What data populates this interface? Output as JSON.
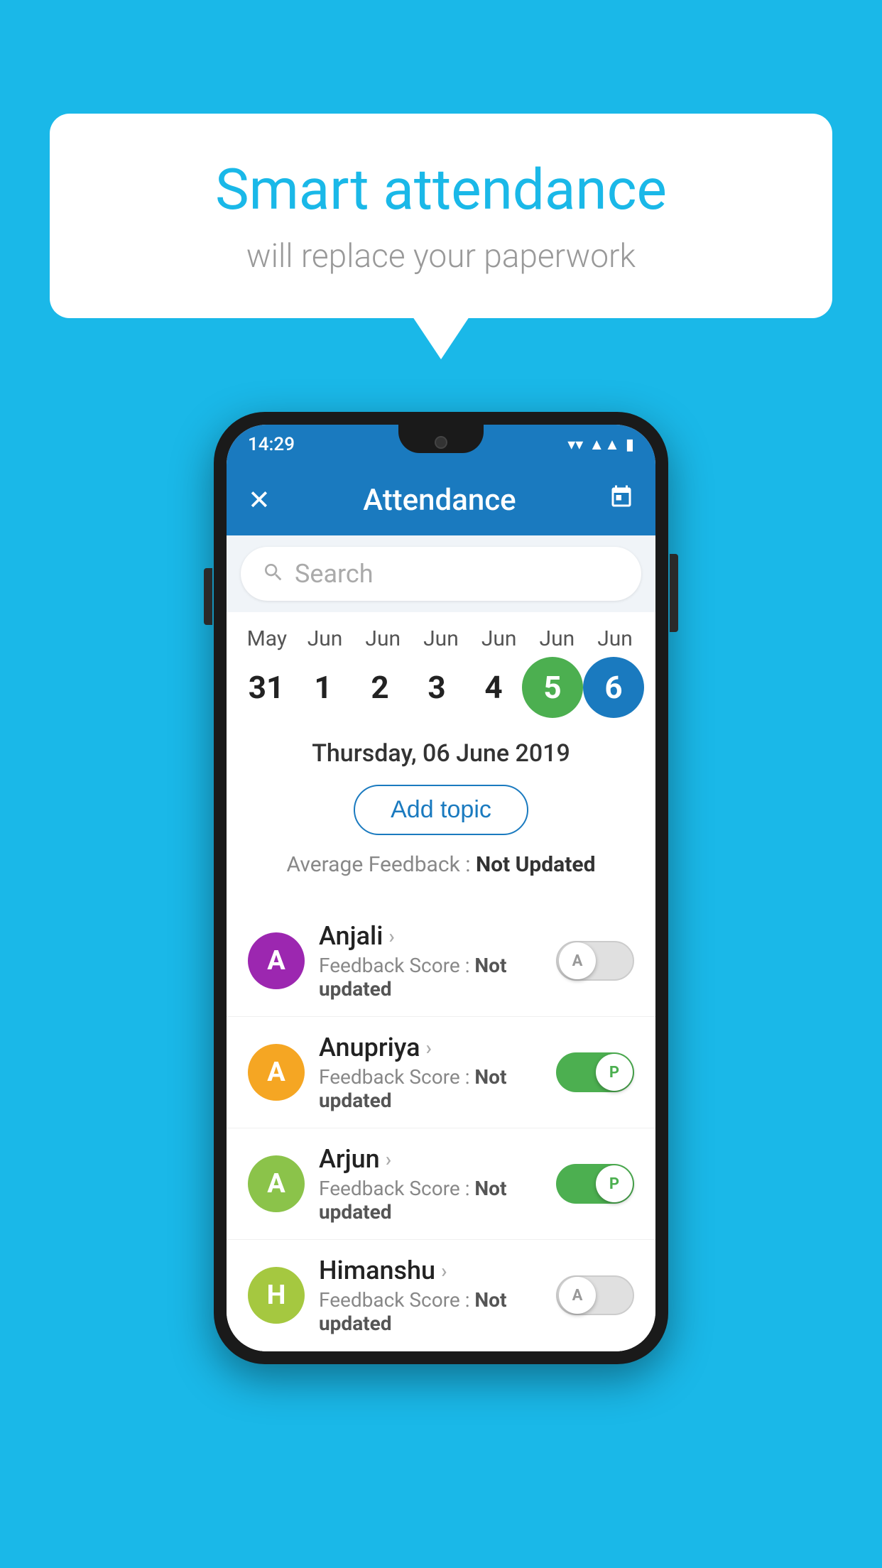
{
  "background": {
    "color": "#1ab8e8"
  },
  "speech_bubble": {
    "title": "Smart attendance",
    "subtitle": "will replace your paperwork"
  },
  "status_bar": {
    "time": "14:29",
    "wifi": "▼",
    "signal": "▲",
    "battery": "▮"
  },
  "app_bar": {
    "title": "Attendance",
    "close_icon": "✕",
    "calendar_icon": "📅"
  },
  "search": {
    "placeholder": "Search"
  },
  "calendar": {
    "months": [
      "May",
      "Jun",
      "Jun",
      "Jun",
      "Jun",
      "Jun",
      "Jun"
    ],
    "days": [
      "31",
      "1",
      "2",
      "3",
      "4",
      "5",
      "6"
    ],
    "selected_green": "5",
    "selected_blue": "6"
  },
  "selected_date": "Thursday, 06 June 2019",
  "add_topic_label": "Add topic",
  "avg_feedback_label": "Average Feedback : ",
  "avg_feedback_value": "Not Updated",
  "students": [
    {
      "name": "Anjali",
      "avatar_letter": "A",
      "avatar_color": "#9c27b0",
      "feedback_label": "Feedback Score : ",
      "feedback_value": "Not updated",
      "toggle_state": "off",
      "toggle_letter": "A"
    },
    {
      "name": "Anupriya",
      "avatar_letter": "A",
      "avatar_color": "#f5a623",
      "feedback_label": "Feedback Score : ",
      "feedback_value": "Not updated",
      "toggle_state": "on",
      "toggle_letter": "P"
    },
    {
      "name": "Arjun",
      "avatar_letter": "A",
      "avatar_color": "#8bc34a",
      "feedback_label": "Feedback Score : ",
      "feedback_value": "Not updated",
      "toggle_state": "on",
      "toggle_letter": "P"
    },
    {
      "name": "Himanshu",
      "avatar_letter": "H",
      "avatar_color": "#a5c840",
      "feedback_label": "Feedback Score : ",
      "feedback_value": "Not updated",
      "toggle_state": "off",
      "toggle_letter": "A"
    }
  ]
}
